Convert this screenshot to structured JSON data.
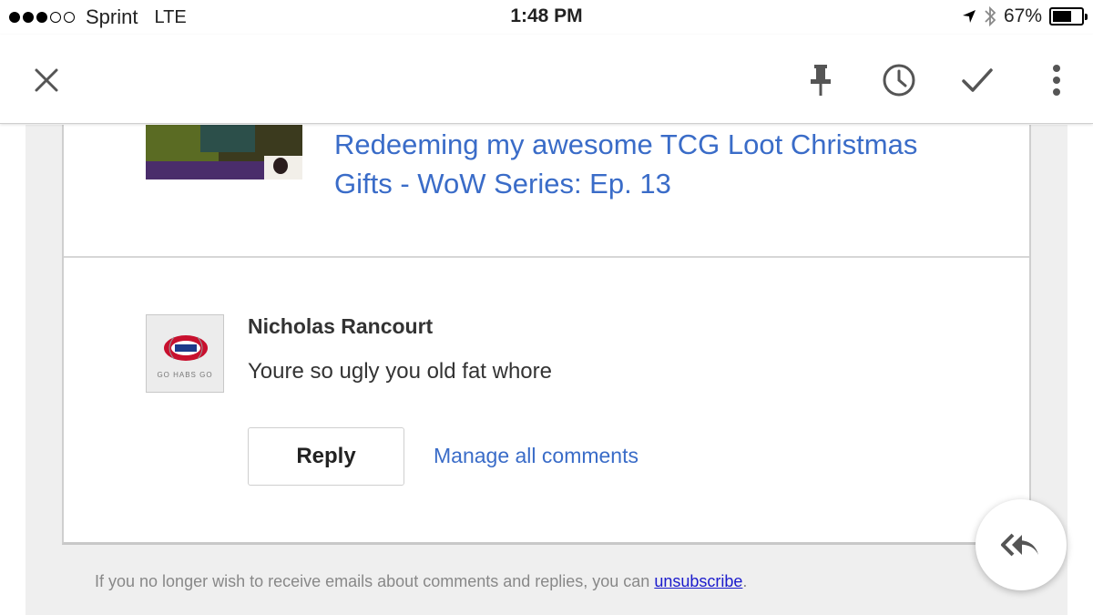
{
  "status_bar": {
    "carrier": "Sprint",
    "network": "LTE",
    "time": "1:48 PM",
    "battery_percent": "67%",
    "battery_level": 0.67,
    "signal_bars_filled": 3,
    "signal_bars_total": 5
  },
  "toolbar": {
    "icons": [
      "close-icon",
      "pin-icon",
      "clock-icon",
      "check-icon",
      "more-vert-icon"
    ]
  },
  "video": {
    "title": "Redeeming my awesome TCG Loot Christmas Gifts - WoW Series: Ep. 13"
  },
  "comment": {
    "author": "Nicholas Rancourt",
    "text": "Youre so ugly you old fat whore",
    "avatar_text": "GO HABS GO"
  },
  "actions": {
    "reply_label": "Reply",
    "manage_label": "Manage all comments"
  },
  "footer": {
    "text": "If you no longer wish to receive emails about comments and replies, you can ",
    "link": "unsubscribe",
    "end": "."
  },
  "colors": {
    "link_blue": "#3a6cc8",
    "footer_link": "#1a1acc",
    "background_gray": "#efefef"
  }
}
